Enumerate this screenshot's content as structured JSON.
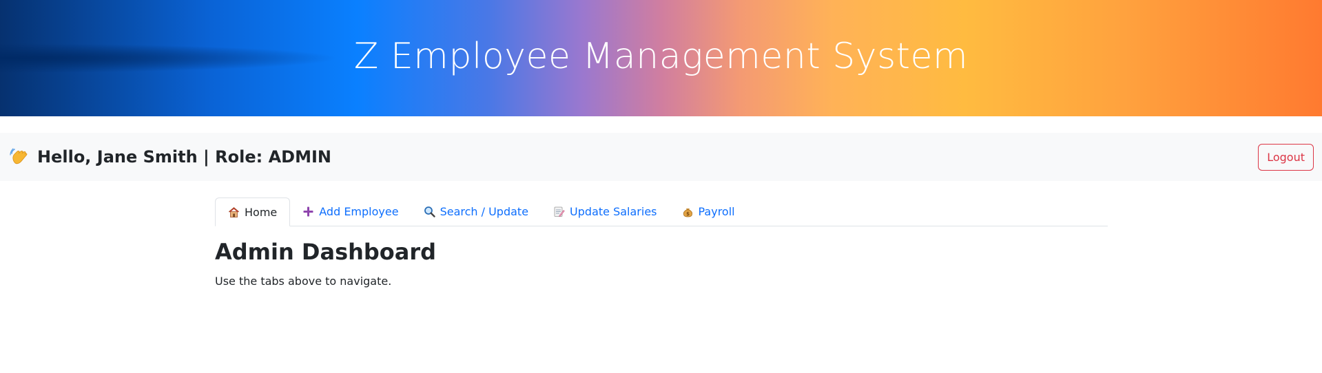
{
  "header": {
    "title": "Z Employee Management System"
  },
  "userbar": {
    "greeting": "Hello, Jane Smith | Role: ADMIN",
    "greeting_icon": "waving-hand-icon",
    "logout_label": "Logout"
  },
  "tabs": [
    {
      "label": "Home",
      "icon": "house-icon",
      "active": true
    },
    {
      "label": "Add Employee",
      "icon": "plus-icon",
      "active": false
    },
    {
      "label": "Search / Update",
      "icon": "magnifier-icon",
      "active": false
    },
    {
      "label": "Update Salaries",
      "icon": "memo-icon",
      "active": false
    },
    {
      "label": "Payroll",
      "icon": "money-bag-icon",
      "active": false
    }
  ],
  "main": {
    "heading": "Admin Dashboard",
    "subtitle": "Use the tabs above to navigate."
  },
  "colors": {
    "link": "#0d6efd",
    "danger": "#dc3545",
    "userbar_bg": "#f8f9fa"
  }
}
